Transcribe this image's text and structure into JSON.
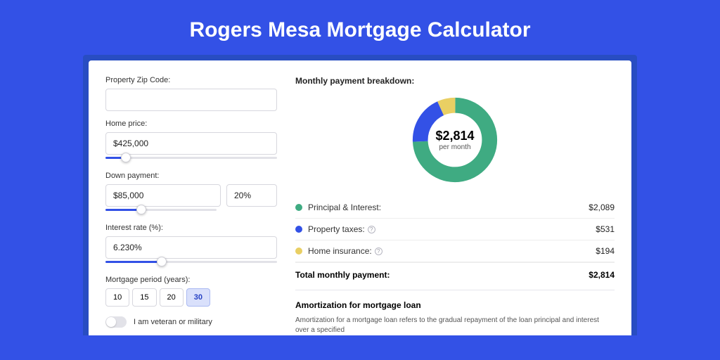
{
  "title": "Rogers Mesa Mortgage Calculator",
  "form": {
    "zip_label": "Property Zip Code:",
    "zip_value": "",
    "home_price_label": "Home price:",
    "home_price_value": "$425,000",
    "down_payment_label": "Down payment:",
    "down_payment_value": "$85,000",
    "down_payment_pct": "20%",
    "interest_label": "Interest rate (%):",
    "interest_value": "6.230%",
    "period_label": "Mortgage period (years):",
    "periods": [
      "10",
      "15",
      "20",
      "30"
    ],
    "period_active_index": 3,
    "veteran_label": "I am veteran or military"
  },
  "breakdown": {
    "title": "Monthly payment breakdown:",
    "center_amount": "$2,814",
    "center_sub": "per month",
    "rows": [
      {
        "label": "Principal & Interest:",
        "value": "$2,089",
        "color": "#3fab82",
        "info": false
      },
      {
        "label": "Property taxes:",
        "value": "$531",
        "color": "#3351e6",
        "info": true
      },
      {
        "label": "Home insurance:",
        "value": "$194",
        "color": "#e9cf63",
        "info": true
      }
    ],
    "total_label": "Total monthly payment:",
    "total_value": "$2,814"
  },
  "chart_data": {
    "type": "pie",
    "title": "Monthly payment breakdown",
    "series": [
      {
        "name": "Principal & Interest",
        "value": 2089,
        "color": "#3fab82"
      },
      {
        "name": "Property taxes",
        "value": 531,
        "color": "#3351e6"
      },
      {
        "name": "Home insurance",
        "value": 194,
        "color": "#e9cf63"
      }
    ],
    "total": 2814,
    "unit": "USD/month"
  },
  "amort": {
    "title": "Amortization for mortgage loan",
    "text": "Amortization for a mortgage loan refers to the gradual repayment of the loan principal and interest over a specified"
  }
}
